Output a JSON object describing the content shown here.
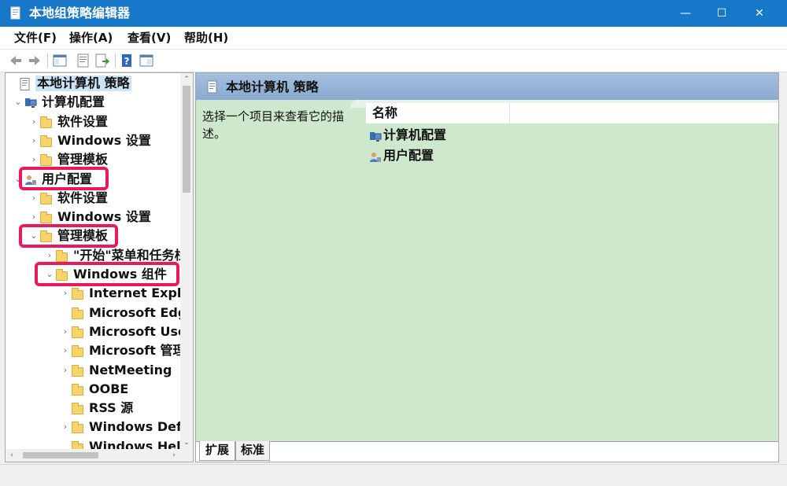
{
  "window": {
    "title": "本地组策略编辑器",
    "controls": {
      "minimize": "—",
      "maximize": "☐",
      "close": "✕"
    }
  },
  "menu": [
    "文件(F)",
    "操作(A)",
    "查看(V)",
    "帮助(H)"
  ],
  "toolbar": [
    "back-icon",
    "forward-icon",
    "show-hide-console-tree-icon",
    "properties-icon",
    "export-list-icon",
    "help-icon",
    "show-hide-action-pane-icon"
  ],
  "tree": {
    "items": [
      {
        "label": "本地计算机 策略",
        "icon": "policy-icon",
        "expander": "",
        "selected": true
      },
      {
        "label": "计算机配置",
        "icon": "computer-config-icon",
        "expander": "⌄"
      },
      {
        "label": "软件设置",
        "icon": "folder-icon",
        "expander": "›"
      },
      {
        "label": "Windows 设置",
        "icon": "folder-icon",
        "expander": "›"
      },
      {
        "label": "管理模板",
        "icon": "folder-icon",
        "expander": "›"
      },
      {
        "label": "用户配置",
        "icon": "user-config-icon",
        "expander": "⌄",
        "highlighted": true
      },
      {
        "label": "软件设置",
        "icon": "folder-icon",
        "expander": "›"
      },
      {
        "label": "Windows 设置",
        "icon": "folder-icon",
        "expander": "›"
      },
      {
        "label": "管理模板",
        "icon": "folder-icon",
        "expander": "⌄",
        "highlighted": true
      },
      {
        "label": "\"开始\"菜单和任务栏",
        "icon": "folder-icon",
        "expander": "›"
      },
      {
        "label": "Windows 组件",
        "icon": "folder-icon",
        "expander": "⌄",
        "highlighted": true
      },
      {
        "label": "Internet Explorer",
        "icon": "folder-icon",
        "expander": "›"
      },
      {
        "label": "Microsoft Edge",
        "icon": "folder-icon",
        "expander": ""
      },
      {
        "label": "Microsoft User Experience Virtualization",
        "icon": "folder-icon",
        "expander": "›"
      },
      {
        "label": "Microsoft 管理控制台",
        "icon": "folder-icon",
        "expander": "›"
      },
      {
        "label": "NetMeeting",
        "icon": "folder-icon",
        "expander": "›"
      },
      {
        "label": "OOBE",
        "icon": "folder-icon",
        "expander": ""
      },
      {
        "label": "RSS 源",
        "icon": "folder-icon",
        "expander": ""
      },
      {
        "label": "Windows Defender",
        "icon": "folder-icon",
        "expander": "›"
      },
      {
        "label": "Windows Hello",
        "icon": "folder-icon",
        "expander": ""
      }
    ],
    "scroll": {
      "up": "⌃",
      "down": "⌄",
      "left": "‹",
      "right": "›"
    }
  },
  "details": {
    "header_title": "本地计算机 策略",
    "description": "选择一个项目来查看它的描述。",
    "column_name": "名称",
    "items": [
      {
        "label": "计算机配置",
        "icon": "computer-config-icon"
      },
      {
        "label": "用户配置",
        "icon": "user-config-icon"
      }
    ],
    "tabs": [
      "扩展",
      "标准"
    ]
  },
  "colors": {
    "titlebar": "#1778c9",
    "highlight": "#e8195e",
    "detail_background": "#cde8cd",
    "header_background": "#a5bfdf"
  }
}
